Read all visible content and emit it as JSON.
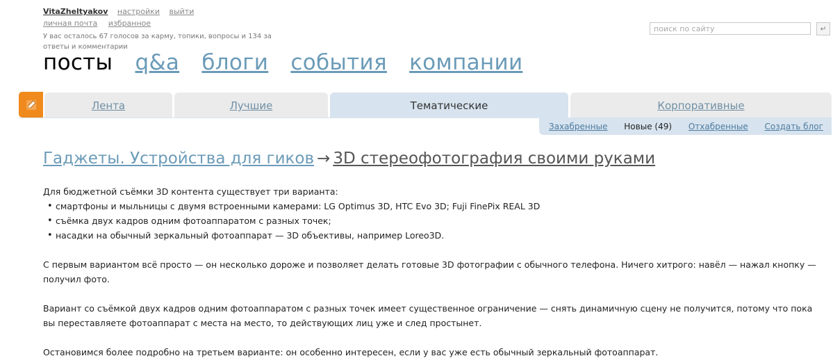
{
  "user": {
    "name": "VitaZheltyakov",
    "links_row1": [
      "настройки",
      "выйти"
    ],
    "links_row2": [
      "личная почта",
      "избранное"
    ],
    "votes_text": "У вас осталось 67 голосов за карму, топики, вопросы и 134 за ответы и комментарии"
  },
  "search": {
    "placeholder": "поиск по сайту",
    "button_glyph": "↵"
  },
  "main_nav": [
    {
      "label": "посты",
      "active": true
    },
    {
      "label": "q&a",
      "active": false
    },
    {
      "label": "блоги",
      "active": false
    },
    {
      "label": "события",
      "active": false
    },
    {
      "label": "компании",
      "active": false
    }
  ],
  "tabs": [
    {
      "label": "Лента",
      "active": false
    },
    {
      "label": "Лучшие",
      "active": false
    },
    {
      "label": "Тематические",
      "active": true
    },
    {
      "label": "Корпоративные",
      "active": false
    }
  ],
  "subnav": [
    {
      "label": "Захабренные",
      "current": false
    },
    {
      "label": "Новые (49)",
      "current": true
    },
    {
      "label": "Отхабренные",
      "current": false
    },
    {
      "label": "Создать блог",
      "current": false
    }
  ],
  "post": {
    "blog": "Гаджеты. Устройства для гиков",
    "arrow": "→",
    "title": "3D стереофотография своими руками",
    "intro": "Для бюджетной съёмки 3D контента существует три варианта:",
    "bullets": [
      "смартфоны и мыльницы с двумя встроенными камерами: LG Optimus 3D, HTC Evo 3D; Fuji FinePix REAL 3D",
      "съёмка двух кадров одним фотоаппаратом с разных точек;",
      "насадки на обычный зеркальный фотоаппарат — 3D объективы, например Loreo3D."
    ],
    "paragraph1": "С первым вариантом всё просто — он несколько дороже и позволяет делать готовые 3D фотографии с обычного телефона. Ничего хитрого: навёл — нажал кнопку — получил фото.",
    "paragraph2": "Вариант со съёмкой двух кадров одним фотоаппаратом с разных точек имеет существенное ограничение — снять динамичную сцену не получится, потому что пока вы переставляете фотоаппарат с места на место, то действующих лиц уже и след простынет.",
    "paragraph3": "Остановимся более подробно на третьем варианте: он особенно интересен, если у вас уже есть обычный зеркальный фотоаппарат."
  },
  "colors": {
    "accent_orange": "#f08a1c",
    "link_blue": "#6b9bb8",
    "tab_active_bg": "#d7e3ee"
  }
}
